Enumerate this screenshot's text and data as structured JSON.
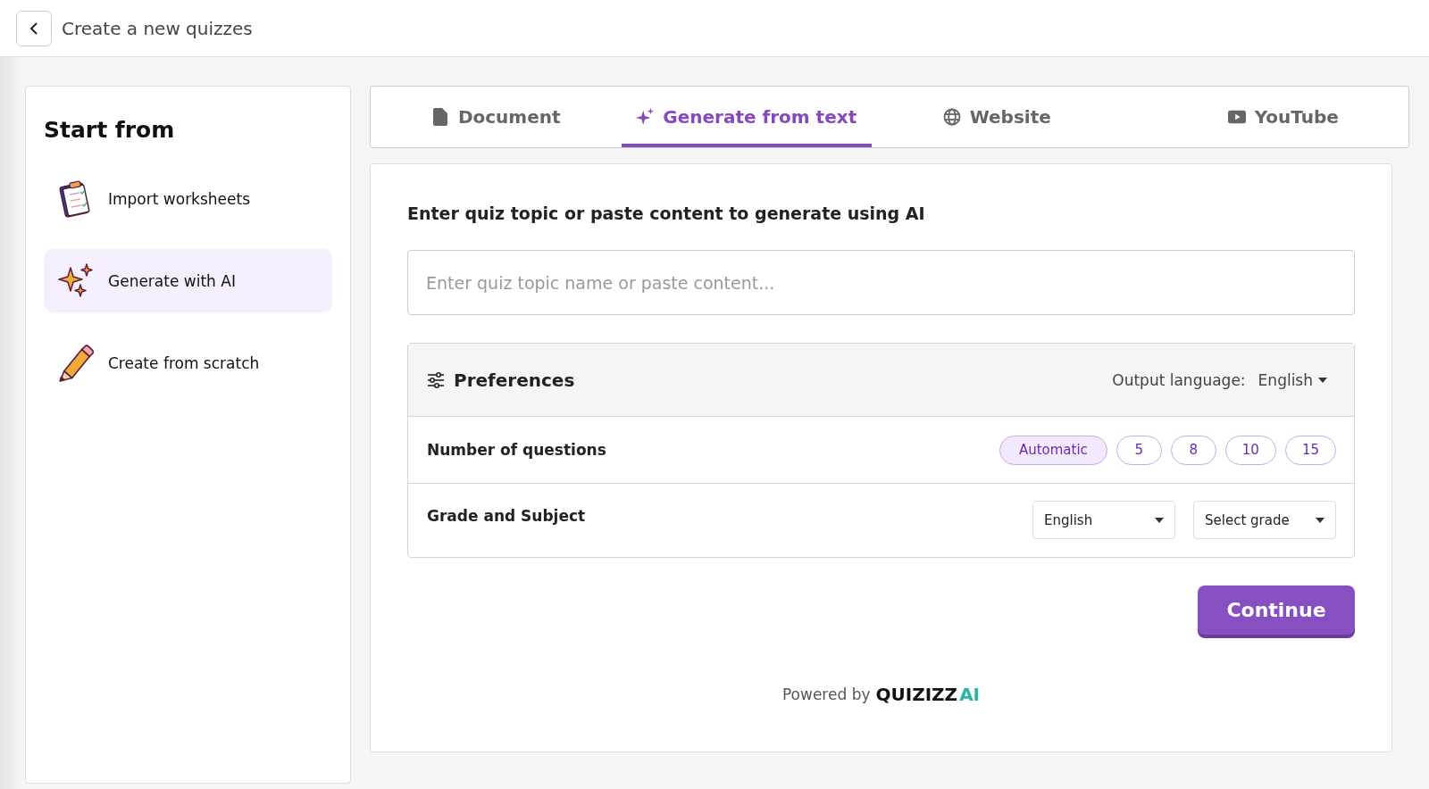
{
  "header": {
    "title": "Create a new quizzes"
  },
  "sidebar": {
    "title": "Start from",
    "items": [
      {
        "label": "Import worksheets",
        "kind": "clipboard",
        "selected": false
      },
      {
        "label": "Generate with AI",
        "kind": "sparkles",
        "selected": true
      },
      {
        "label": "Create from scratch",
        "kind": "pencil",
        "selected": false
      }
    ]
  },
  "tabs": [
    {
      "label": "Document",
      "kind": "document",
      "selected": false
    },
    {
      "label": "Generate from text",
      "kind": "sparkle",
      "selected": true
    },
    {
      "label": "Website",
      "kind": "globe",
      "selected": false
    },
    {
      "label": "YouTube",
      "kind": "play",
      "selected": false
    }
  ],
  "form": {
    "prompt": "Enter quiz topic or paste content to generate using AI",
    "input": {
      "placeholder": "Enter quiz topic name or paste content..."
    },
    "preferences": {
      "title": "Preferences",
      "output_language_label": "Output language:",
      "output_language": "English",
      "questions_label": "Number of questions",
      "question_options": [
        {
          "label": "Automatic",
          "selected": true
        },
        {
          "label": "5",
          "selected": false
        },
        {
          "label": "8",
          "selected": false
        },
        {
          "label": "10",
          "selected": false
        },
        {
          "label": "15",
          "selected": false
        }
      ],
      "grade_label": "Grade and Subject",
      "subject": "English",
      "grade": "Select grade"
    },
    "continue_button": "Continue",
    "powered_by": "Powered by",
    "brand": "QUIZIZZ",
    "brand_suffix": "AI"
  }
}
